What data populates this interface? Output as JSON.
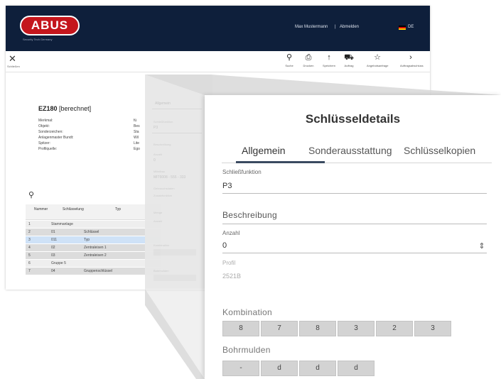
{
  "header": {
    "brand": "ABUS",
    "tagline": "Security Tech Germany",
    "user_name": "Max Mustermann",
    "separator": "|",
    "logout_label": "Abmelden",
    "language": "DE"
  },
  "toolbar": {
    "close_label": "Schließen",
    "items": [
      {
        "icon": "search-icon",
        "label": "Suche"
      },
      {
        "icon": "print-icon",
        "label": "Drucken"
      },
      {
        "icon": "upload-icon",
        "label": "Speichern"
      },
      {
        "icon": "cart-icon",
        "label": "Auftrag"
      },
      {
        "icon": "star-icon",
        "label": "Angebotsanfrage"
      },
      {
        "icon": "chevron-right-icon",
        "label": "Auftragsabschluss"
      }
    ]
  },
  "product": {
    "code": "EZ180",
    "status": "[berechnet]",
    "meta_labels": [
      "Merkmal:",
      "Objekt:",
      "Sonderzeichen:",
      "Anlagenmaster Bundt:",
      "Spitzer:",
      "Profilquelle:"
    ],
    "meta_values": [
      "fü",
      "Bes",
      "Sta",
      "Wil",
      "Lite",
      "Ego"
    ]
  },
  "grid": {
    "headers": [
      "Nummer",
      "Schlüsselung",
      "Typ"
    ],
    "rows": [
      {
        "n": "1",
        "c": "Stammanlage",
        "d": "",
        "t": "grp"
      },
      {
        "n": "2",
        "c": "01",
        "d": "Schlüssel",
        "t": "alt"
      },
      {
        "n": "3",
        "c": "011",
        "d": "Typ",
        "t": "sel"
      },
      {
        "n": "4",
        "c": "02",
        "d": "Zentraleisen 1",
        "t": "alt"
      },
      {
        "n": "5",
        "c": "03",
        "d": "Zentraleisen 2",
        "t": "alt"
      },
      {
        "n": "6",
        "c": "Gruppe 5",
        "d": "",
        "t": "grp"
      },
      {
        "n": "7",
        "c": "04",
        "d": "Gruppenschlüssel",
        "t": "alt"
      }
    ]
  },
  "mid": {
    "tab": "Allgemein",
    "fields": [
      "Schließfunktion",
      "P3",
      "Beschreibung",
      "Anzahl",
      "0",
      "Mittelbau",
      "MIT6008 - 555 - 333",
      "Gebrauchsdaten",
      "Zusatzfunktion",
      "Menge",
      "Anzahl",
      "Kombination",
      "Bohrmulden"
    ]
  },
  "dialog": {
    "title": "Schlüsseldetails",
    "tabs": [
      "Allgemein",
      "Sonderausstattung",
      "Schlüsselkopien"
    ],
    "schliessfunktion_label": "Schließfunktion",
    "schliessfunktion_value": "P3",
    "beschreibung_label": "Beschreibung",
    "anzahl_label": "Anzahl",
    "anzahl_value": "0",
    "profil_label": "Profil",
    "profil_value": "2521B",
    "kombination_label": "Kombination",
    "kombination_values": [
      "8",
      "7",
      "8",
      "3",
      "2",
      "3"
    ],
    "bohrmulden_label": "Bohrmulden",
    "bohrmulden_values": [
      "-",
      "d",
      "d",
      "d"
    ]
  },
  "colors": {
    "header_bg": "#0e1f3b",
    "brand_red": "#c4161c",
    "tab_underline": "#3a4a60",
    "selected_row": "#cfe2f7"
  }
}
